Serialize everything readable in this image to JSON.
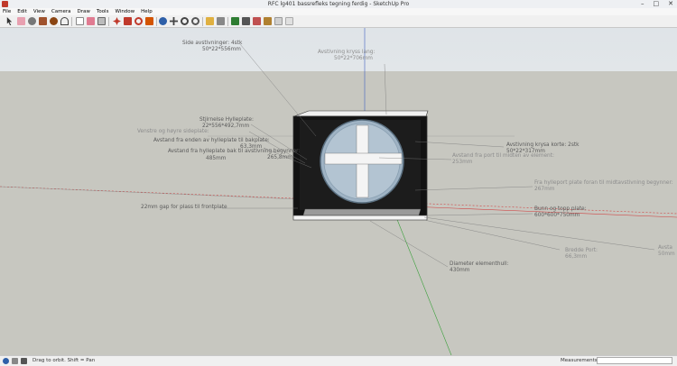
{
  "window": {
    "title": "RFC lg401 bassrefleks tegning ferdig - SketchUp Pro",
    "minimize_glyph": "–",
    "maximize_glyph": "□",
    "close_glyph": "✕"
  },
  "menu": [
    "File",
    "Edit",
    "View",
    "Camera",
    "Draw",
    "Tools",
    "Window",
    "Help"
  ],
  "toolbar_icons": [
    "select-icon",
    "eraser-icon",
    "paint-bucket-icon",
    "rectangle-icon",
    "circle-icon",
    "arc-icon",
    "freehand-icon",
    "push-pull-icon",
    "offset-icon",
    "move-icon",
    "rotate-icon",
    "scale-icon",
    "follow-me-icon",
    "tape-measure-icon",
    "text-icon",
    "protractor-icon",
    "axes-icon",
    "dimension-icon",
    "orbit-icon",
    "pan-icon",
    "zoom-icon",
    "zoom-extents-icon",
    "previous-view-icon",
    "warehouse-icon",
    "extension-warehouse-icon",
    "share-model-icon",
    "layout-icon",
    "model-info-icon",
    "component-icon"
  ],
  "annotations": {
    "side_struts": {
      "line1": "Side avstivninger:  4stk",
      "line2": "50*22*556mm"
    },
    "cross_brace_long": {
      "line1": "Avstivning kryss lang:",
      "line2": "50*22*706mm"
    },
    "shelf_thickness": {
      "line1": "Stjirnelse Hylleplate:",
      "line2": "22*556*492,7mm"
    },
    "left_right_sides": {
      "line1": "Venstre og høyre sideplate:",
      "line2": ""
    },
    "shelf_to_back": {
      "line1": "Avstand fra enden av hylleplate til bakplate:",
      "line2": "63,3mm"
    },
    "shelf_to_bracing": {
      "line1": "Avstand fra hylleplate bak til avstivning begynner:",
      "line2": "265,8mm"
    },
    "depth_value": {
      "line1": "485mm"
    },
    "cross_brace_short": {
      "line1": "Avstivning krysa korte:  2stk",
      "line2": "50*22*317mm"
    },
    "port_to_element": {
      "line1": "Avstand fra port til midten av element:",
      "line2": "253mm"
    },
    "port_front_to_brace": {
      "line1": "Fra hylleport plate foran til midtavstivning begynner:",
      "line2": "267mm"
    },
    "gap_front": {
      "line1": "22mm gap for plass til frontplate"
    },
    "bottom_top": {
      "line1": "Bunn og topp plate:",
      "line2": "600*600*750mm"
    },
    "port_width": {
      "line1": "Bredde Port:",
      "line2": "66,3mm"
    },
    "element_diameter": {
      "line1": "Diameter elementhull:",
      "line2": "430mm"
    },
    "right_edge": {
      "line1": "Avsta",
      "line2": "50mm"
    }
  },
  "status": {
    "hint": "Drag to orbit.  Shift = Pan",
    "measurements_label": "Measurements",
    "measurements_value": ""
  }
}
